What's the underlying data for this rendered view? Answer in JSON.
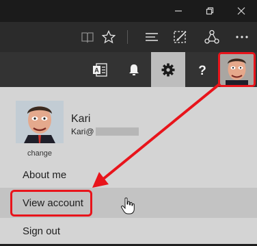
{
  "window_controls": {
    "minimize_icon": "minimize-icon",
    "restore_icon": "restore-icon",
    "close_icon": "close-icon"
  },
  "browser_toolbar": {
    "icons": [
      "reading-view-icon",
      "favorite-star-icon",
      "hub-icon",
      "web-note-icon",
      "share-icon",
      "more-icon"
    ]
  },
  "app_bar": {
    "icons": [
      "exchange-icon",
      "notification-bell-icon",
      "settings-gear-icon",
      "help-icon",
      "profile-avatar-icon"
    ],
    "active": "settings-gear-icon"
  },
  "account_menu": {
    "change_label": "change",
    "user_name": "Kari",
    "user_email": "Kari@",
    "items": [
      {
        "label": "About me"
      },
      {
        "label": "View account"
      },
      {
        "label": "Sign out"
      }
    ]
  },
  "colors": {
    "annotation_red": "#e8141b",
    "menu_background": "#d4d4d4",
    "app_bar_background": "#333333",
    "toolbar_background": "#2b2b2b"
  }
}
